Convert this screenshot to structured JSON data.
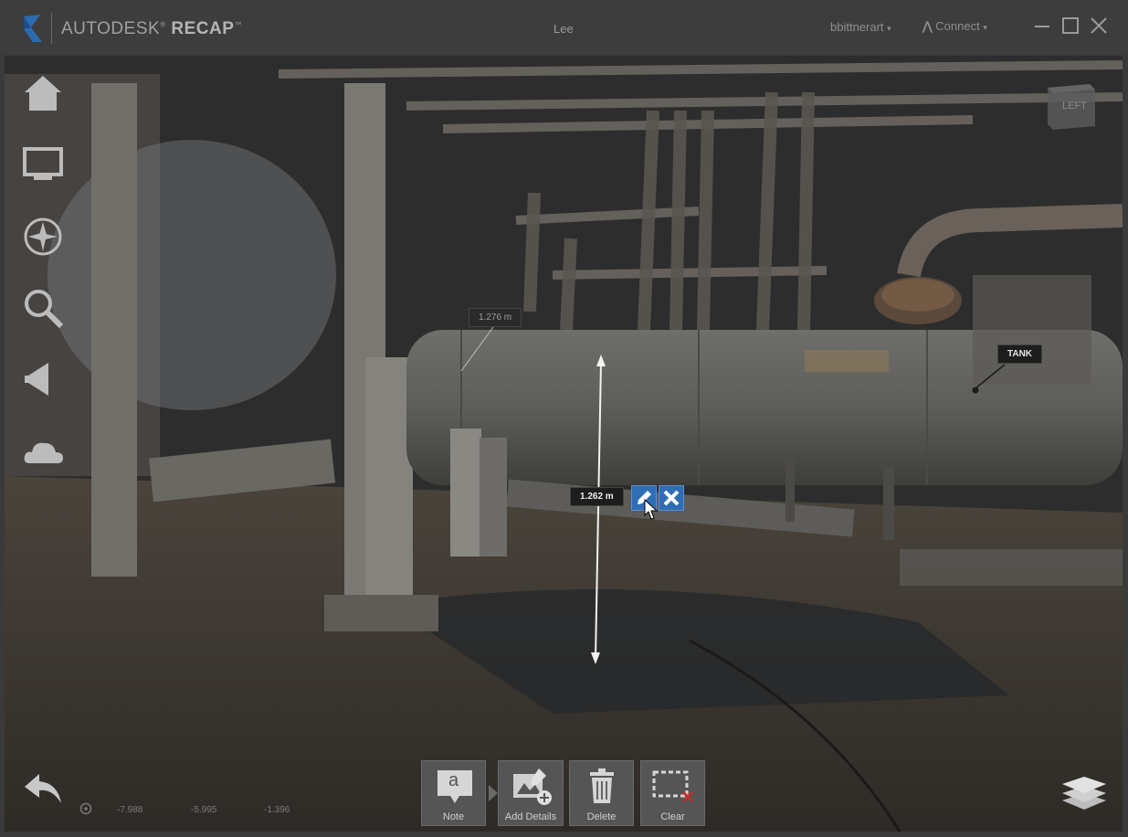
{
  "titlebar": {
    "brand_light": "AUTODESK",
    "brand_bold": "RECAP",
    "project_name": "Lee",
    "user_menu": "bbittnerart",
    "connect_menu": "Connect",
    "chevron": "▾"
  },
  "nav": {
    "items": [
      {
        "icon": "home-icon"
      },
      {
        "icon": "monitor-icon"
      },
      {
        "icon": "compass-icon"
      },
      {
        "icon": "zoom-icon"
      },
      {
        "icon": "megaphone-icon"
      },
      {
        "icon": "cloud-icon"
      }
    ]
  },
  "viewcube": {
    "face_label": "LEFT"
  },
  "measurements": {
    "secondary_label": "1.276 m",
    "active_label": "1.262 m"
  },
  "tags": {
    "tank_label": "TANK"
  },
  "toolbar": {
    "note_label": "Note",
    "note_glyph": "a",
    "add_details_label": "Add Details",
    "delete_label": "Delete",
    "clear_label": "Clear"
  },
  "coordinates": {
    "x": "-7.988",
    "y": "-5.995",
    "z": "-1.396"
  },
  "colors": {
    "accent_blue": "#2f6db5",
    "titlebar_bg": "#3d3d3d",
    "clear_red": "#c03030"
  }
}
